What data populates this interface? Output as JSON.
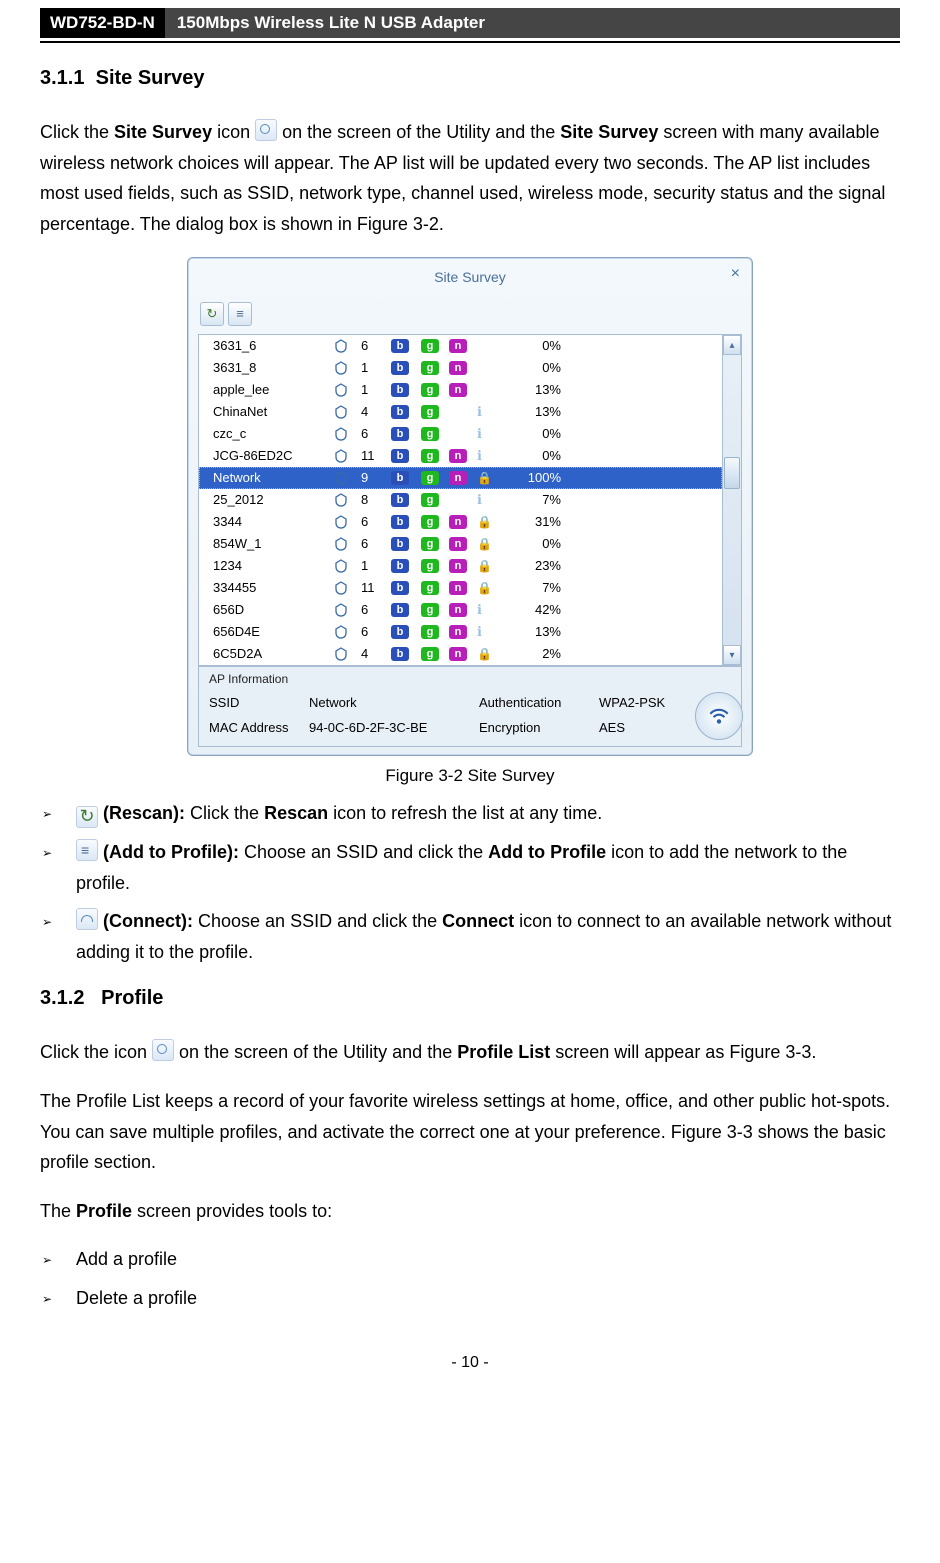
{
  "header": {
    "model": "WD752-BD-N",
    "product": "150Mbps Wireless Lite N USB Adapter"
  },
  "sections": {
    "site_survey": {
      "number": "3.1.1",
      "title": "Site Survey"
    },
    "profile": {
      "number": "3.1.2",
      "title": "Profile"
    }
  },
  "intro": {
    "p1_a": "Click the ",
    "p1_b1": "Site Survey",
    "p1_c": " icon ",
    "p1_d": " on the screen of the Utility and the ",
    "p1_b2": "Site Survey",
    "p1_e": " screen with many available wireless network choices will appear. The AP list will be updated every two seconds. The AP list includes most used fields, such as SSID, network type, channel used, wireless mode, security status and the signal percentage. The dialog box is shown in Figure 3-2."
  },
  "dialog": {
    "title": "Site Survey",
    "selected_index": 6,
    "ap_info": {
      "section": "AP Information",
      "ssid_lbl": "SSID",
      "ssid_val": "Network",
      "auth_lbl": "Authentication",
      "auth_val": "WPA2-PSK",
      "mac_lbl": "MAC Address",
      "mac_val": "94-0C-6D-2F-3C-BE",
      "enc_lbl": "Encryption",
      "enc_val": "AES"
    },
    "rows": [
      {
        "ssid": "3631_6",
        "ch": "6",
        "b": true,
        "g": true,
        "n": true,
        "sec": "open",
        "signal": "0%"
      },
      {
        "ssid": "3631_8",
        "ch": "1",
        "b": true,
        "g": true,
        "n": true,
        "sec": "open",
        "signal": "0%"
      },
      {
        "ssid": "apple_lee",
        "ch": "1",
        "b": true,
        "g": true,
        "n": true,
        "sec": "open",
        "signal": "13%"
      },
      {
        "ssid": "ChinaNet",
        "ch": "4",
        "b": true,
        "g": true,
        "n": false,
        "sec": "none",
        "signal": "13%"
      },
      {
        "ssid": "czc_c",
        "ch": "6",
        "b": true,
        "g": true,
        "n": false,
        "sec": "none",
        "signal": "0%"
      },
      {
        "ssid": "JCG-86ED2C",
        "ch": "11",
        "b": true,
        "g": true,
        "n": true,
        "sec": "none",
        "signal": "0%"
      },
      {
        "ssid": "Network",
        "ch": "9",
        "b": true,
        "g": true,
        "n": true,
        "sec": "lock",
        "signal": "100%"
      },
      {
        "ssid": "25_2012",
        "ch": "8",
        "b": true,
        "g": true,
        "n": false,
        "sec": "none",
        "signal": "7%"
      },
      {
        "ssid": "3344",
        "ch": "6",
        "b": true,
        "g": true,
        "n": true,
        "sec": "lock",
        "signal": "31%"
      },
      {
        "ssid": "854W_1",
        "ch": "6",
        "b": true,
        "g": true,
        "n": true,
        "sec": "lock",
        "signal": "0%"
      },
      {
        "ssid": "1234",
        "ch": "1",
        "b": true,
        "g": true,
        "n": true,
        "sec": "lock",
        "signal": "23%"
      },
      {
        "ssid": "334455",
        "ch": "11",
        "b": true,
        "g": true,
        "n": true,
        "sec": "lock",
        "signal": "7%"
      },
      {
        "ssid": "656D",
        "ch": "6",
        "b": true,
        "g": true,
        "n": true,
        "sec": "none",
        "signal": "42%"
      },
      {
        "ssid": "656D4E",
        "ch": "6",
        "b": true,
        "g": true,
        "n": true,
        "sec": "none",
        "signal": "13%"
      },
      {
        "ssid": "6C5D2A",
        "ch": "4",
        "b": true,
        "g": true,
        "n": true,
        "sec": "lock",
        "signal": "2%"
      }
    ]
  },
  "caption": "Figure 3-2 Site Survey",
  "bullets": {
    "rescan": {
      "label": "(Rescan):",
      "text": " Click the ",
      "bold": "Rescan",
      "text2": " icon to refresh the list at any time."
    },
    "add": {
      "label": "(Add to Profile):",
      "text": " Choose an SSID and click the ",
      "bold": "Add to Profile",
      "text2": " icon to add the network to the profile."
    },
    "connect": {
      "label": "(Connect):",
      "text": " Choose an SSID and click the ",
      "bold": "Connect",
      "text2": " icon to connect to an available network without adding it to the profile."
    }
  },
  "profile_intro": {
    "p1_a": "Click the icon ",
    "p1_b": " on the screen of the Utility and the ",
    "p1_bold": "Profile List",
    "p1_c": " screen will appear as Figure 3-3.",
    "p2": "The Profile List keeps a record of your favorite wireless settings at home, office, and other public hot-spots. You can save multiple profiles, and activate the correct one at your preference. Figure 3-3 shows the basic profile section.",
    "p3_a": "The ",
    "p3_bold": "Profile",
    "p3_b": " screen provides tools to:"
  },
  "profile_bullets": {
    "b1": "Add a profile",
    "b2": "Delete a profile"
  },
  "footer": "- 10 -"
}
